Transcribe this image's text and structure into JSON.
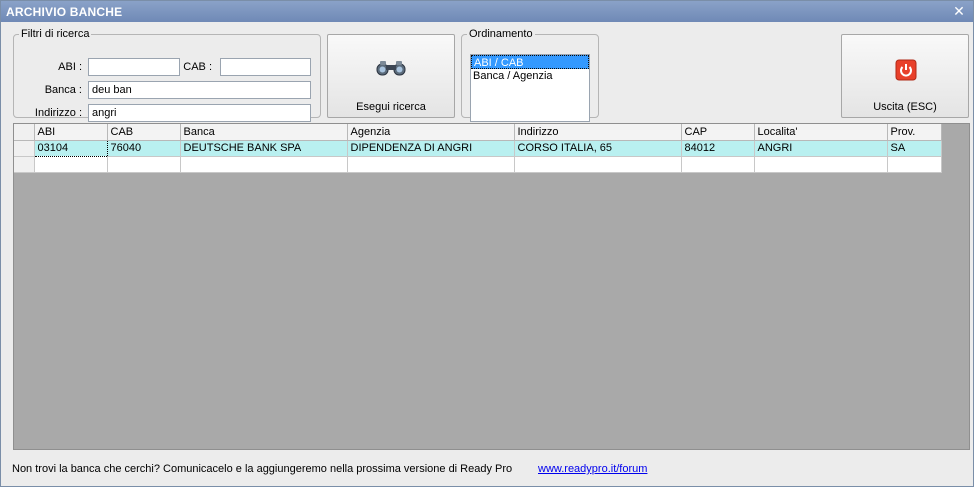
{
  "window": {
    "title": "ARCHIVIO BANCHE",
    "close_glyph": "✕"
  },
  "filters": {
    "legend": "Filtri di ricerca",
    "abi_label": "ABI :",
    "abi_value": "",
    "cab_label": "CAB :",
    "cab_value": "",
    "banca_label": "Banca :",
    "banca_value": "deu ban",
    "indirizzo_label": "Indirizzo :",
    "indirizzo_value": "angri"
  },
  "search_button": {
    "label": "Esegui ricerca",
    "icon": "binoculars-icon"
  },
  "ordering": {
    "legend": "Ordinamento",
    "options": [
      "ABI / CAB",
      "Banca / Agenzia"
    ],
    "selected_index": 0
  },
  "exit_button": {
    "label": "Uscita (ESC)",
    "icon": "power-icon",
    "icon_color": "#e8402a"
  },
  "grid": {
    "columns": [
      "ABI",
      "CAB",
      "Banca",
      "Agenzia",
      "Indirizzo",
      "CAP",
      "Localita'",
      "Prov."
    ],
    "rows": [
      [
        "03104",
        "76040",
        "DEUTSCHE BANK SPA",
        "DIPENDENZA DI ANGRI",
        "CORSO ITALIA, 65",
        "84012",
        "ANGRI",
        "SA"
      ]
    ],
    "highlight_color": "#b9f0f0"
  },
  "footer": {
    "text": "Non trovi la banca che cerchi? Comunicacelo e la aggiungeremo nella prossima versione di Ready Pro",
    "link": "www.readypro.it/forum"
  }
}
